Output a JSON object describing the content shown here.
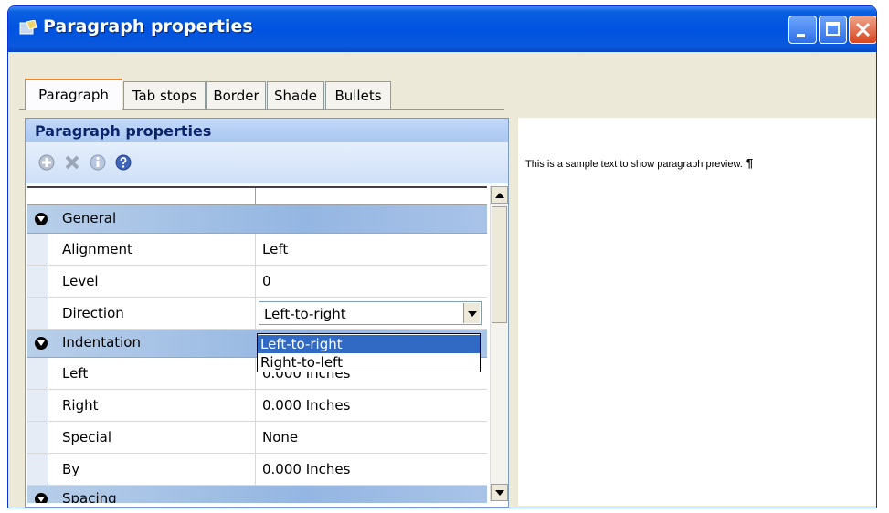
{
  "window": {
    "title": "Paragraph properties",
    "icons": {
      "app": "paragraph-app-icon",
      "minimize": "minimize-icon",
      "maximize": "maximize-icon",
      "close": "close-icon"
    }
  },
  "tabs": [
    {
      "label": "Paragraph",
      "active": true
    },
    {
      "label": "Tab stops",
      "active": false
    },
    {
      "label": "Border",
      "active": false
    },
    {
      "label": "Shade",
      "active": false
    },
    {
      "label": "Bullets",
      "active": false
    }
  ],
  "panel": {
    "header": "Paragraph properties",
    "toolbar": [
      "add-icon",
      "delete-icon",
      "info-icon",
      "help-icon"
    ]
  },
  "grid": {
    "categories": [
      {
        "label": "General",
        "properties": [
          {
            "name": "Alignment",
            "value": "Left"
          },
          {
            "name": "Level",
            "value": "0"
          },
          {
            "name": "Direction",
            "value": "Left-to-right"
          }
        ]
      },
      {
        "label": "Indentation",
        "properties": [
          {
            "name": "Left",
            "value": "0.000 Inches"
          },
          {
            "name": "Right",
            "value": "0.000 Inches"
          },
          {
            "name": "Special",
            "value": "None"
          },
          {
            "name": "By",
            "value": "0.000 Inches"
          }
        ]
      },
      {
        "label": "Spacing",
        "properties": []
      }
    ],
    "dropdown": {
      "options": [
        "Left-to-right",
        "Right-to-left"
      ],
      "selected": "Left-to-right"
    }
  },
  "preview": {
    "text": "This is a sample text to show paragraph preview.",
    "mark": "¶"
  },
  "colors": {
    "title_bar": "#0053e1",
    "panel_header": "#a9c6f0",
    "category_row": "#94b6e2",
    "selection": "#316ac5",
    "tab_highlight": "#e68b2c"
  }
}
